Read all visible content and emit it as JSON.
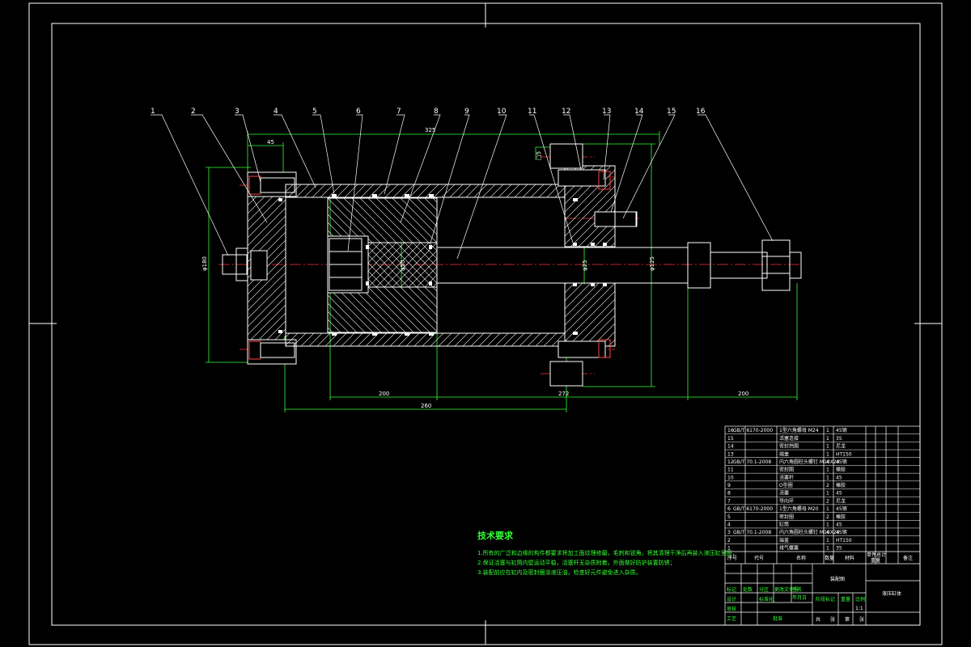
{
  "part_labels": [
    "1",
    "2",
    "3",
    "4",
    "5",
    "6",
    "7",
    "8",
    "9",
    "10",
    "11",
    "12",
    "13",
    "14",
    "15",
    "16"
  ],
  "dimensions": {
    "overall_top": "325",
    "left_offset": "45",
    "left_height": "φ180",
    "rod_small": "φ50",
    "rod_mid": "φ25",
    "right_height": "φ125",
    "flange_small": "□5",
    "bottom_200a": "200",
    "bottom_272": "272",
    "bottom_200b": "200",
    "bottom_260": "260"
  },
  "tech_requirements": {
    "title": "技术要求",
    "items": [
      "1.所有的广泛和边缘的构件都要求将加工面纹理修磨，毛刺和锐角，将其清理干净后再装入液压缸里面；",
      "2.保证活塞与缸筒内壁运动平稳，活塞杆无杂质附着，外面做好防护装置防锈；",
      "3.装配前应在缸内及密封圈涂液压油，检查好元件避免进入杂质。"
    ]
  },
  "title_block": {
    "header": [
      "序号",
      "代号",
      "名称",
      "数量",
      "材料",
      "单件",
      "总计",
      "重量",
      "备注"
    ],
    "rows": [
      {
        "no": "16",
        "code": "GB/T 6170-2000",
        "name": "1型六角螺母 M24",
        "qty": "1",
        "mat": "45钢"
      },
      {
        "no": "15",
        "code": "",
        "name": "活塞连接",
        "qty": "1",
        "mat": "35"
      },
      {
        "no": "14",
        "code": "",
        "name": "密封挡圈",
        "qty": "1",
        "mat": "尼龙"
      },
      {
        "no": "13",
        "code": "",
        "name": "端盖",
        "qty": "1",
        "mat": "HT150"
      },
      {
        "no": "12",
        "code": "GB/T 70.1-2008",
        "name": "内六角圆柱头螺钉 M10X20",
        "qty": "4",
        "mat": "45钢"
      },
      {
        "no": "11",
        "code": "",
        "name": "密封圈",
        "qty": "1",
        "mat": "橡胶"
      },
      {
        "no": "10",
        "code": "",
        "name": "活塞杆",
        "qty": "1",
        "mat": "45"
      },
      {
        "no": "9",
        "code": "",
        "name": "O型圈",
        "qty": "2",
        "mat": "橡胶"
      },
      {
        "no": "8",
        "code": "",
        "name": "活塞",
        "qty": "1",
        "mat": "45"
      },
      {
        "no": "7",
        "code": "",
        "name": "导向环",
        "qty": "2",
        "mat": "尼龙"
      },
      {
        "no": "6",
        "code": "GB/T 6170-2000",
        "name": "1型六角螺母 M20",
        "qty": "1",
        "mat": "45钢"
      },
      {
        "no": "5",
        "code": "",
        "name": "密封圈",
        "qty": "2",
        "mat": "橡胶"
      },
      {
        "no": "4",
        "code": "",
        "name": "缸筒",
        "qty": "1",
        "mat": "45"
      },
      {
        "no": "3",
        "code": "GB/T 70.1-2008",
        "name": "内六角圆柱头螺钉 M10X20",
        "qty": "4",
        "mat": "45钢"
      },
      {
        "no": "2",
        "code": "",
        "name": "端盖",
        "qty": "1",
        "mat": "HT150"
      },
      {
        "no": "1",
        "code": "",
        "name": "排气螺塞",
        "qty": "1",
        "mat": "35"
      }
    ],
    "drawing_type": "装配图",
    "drawing_name": "液压缸体",
    "sign_labels": [
      "标记",
      "处数",
      "分区",
      "更改文件号",
      "签名",
      "年月日"
    ],
    "role_labels": [
      "设计",
      "标准化",
      "审核",
      "工艺",
      "批准"
    ],
    "stage_labels": [
      "阶段标记",
      "重量",
      "比例"
    ],
    "sheet_labels": [
      "共",
      "张",
      "第",
      "张"
    ],
    "scale": "1:1"
  }
}
